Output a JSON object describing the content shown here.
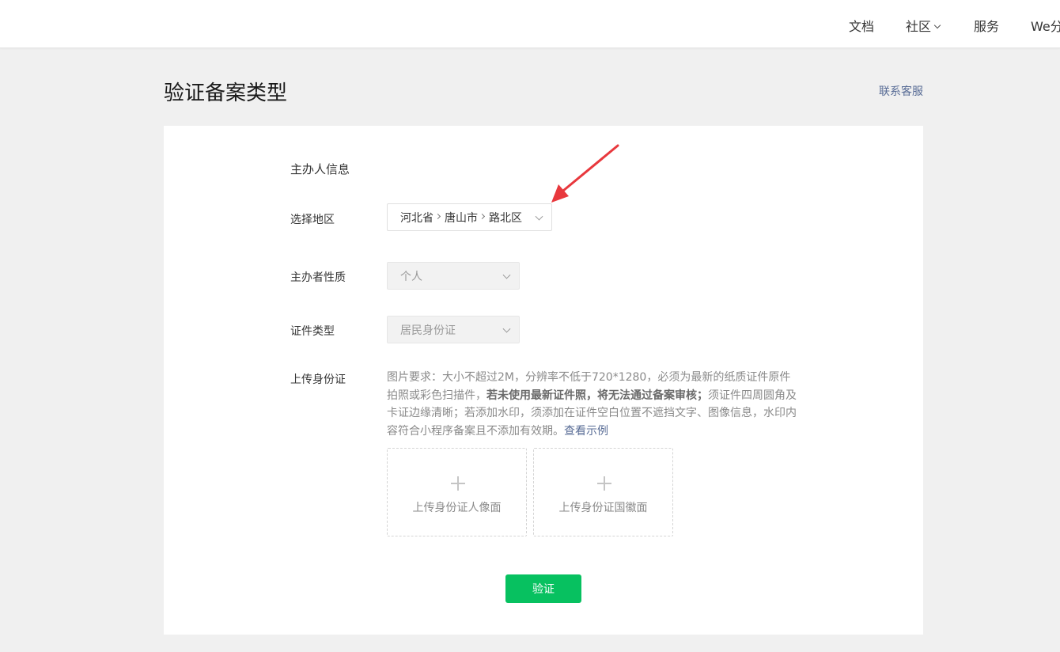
{
  "topnav": {
    "items": [
      {
        "label": "文档"
      },
      {
        "label": "社区"
      },
      {
        "label": "服务"
      },
      {
        "label": "We分"
      }
    ]
  },
  "header": {
    "title": "验证备案类型",
    "contact_link": "联系客服"
  },
  "form": {
    "section_title": "主办人信息",
    "region": {
      "label": "选择地区",
      "province": "河北省",
      "city": "唐山市",
      "district": "路北区",
      "icon": "chevron-down-icon"
    },
    "organizer_nature": {
      "label": "主办者性质",
      "value": "个人",
      "disabled": true
    },
    "id_type": {
      "label": "证件类型",
      "value": "居民身份证",
      "disabled": true
    },
    "upload": {
      "label": "上传身份证",
      "desc_part1": "图片要求：大小不超过2M，分辨率不低于720*1280，必须为最新的纸质证件原件拍照或彩色扫描件，",
      "desc_bold": "若未使用最新证件照，将无法通过备案审核；",
      "desc_part2": "须证件四周圆角及卡证边缘清晰；若添加水印，须添加在证件空白位置不遮挡文字、图像信息，水印内容符合小程序备案且不添加有效期。",
      "example_link": "查看示例",
      "front_label": "上传身份证人像面",
      "back_label": "上传身份证国徽面"
    },
    "submit_label": "验证"
  },
  "colors": {
    "primary_button": "#07c160",
    "link": "#576b95",
    "annotation_arrow": "#e8383d",
    "page_background": "#f0f0f0"
  }
}
